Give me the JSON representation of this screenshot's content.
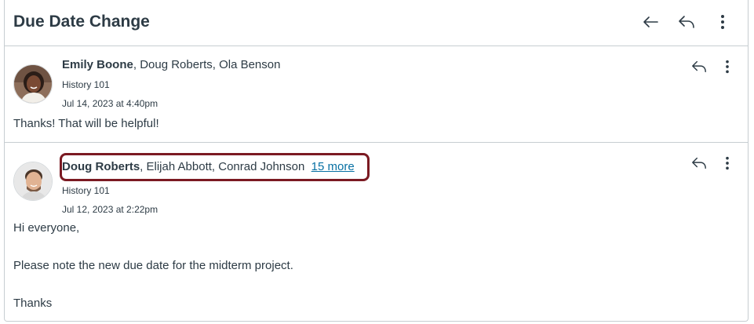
{
  "header": {
    "title": "Due Date Change",
    "icons": [
      "back-arrow-icon",
      "reply-icon",
      "more-vertical-icon"
    ]
  },
  "messages": [
    {
      "sender": "Emily Boone",
      "others": ", Doug Roberts, Ola Benson",
      "course": "History 101",
      "date": "Jul 14, 2023 at 4:40pm",
      "body": [
        "Thanks! That will be helpful!"
      ]
    },
    {
      "sender": "Doug Roberts",
      "others": ", Elijah Abbott, Conrad Johnson",
      "more": "15 more",
      "course": "History 101",
      "date": "Jul 12, 2023 at 2:22pm",
      "body": [
        "Hi everyone,",
        "Please note the new due date for the midterm project.",
        "Thanks"
      ]
    }
  ],
  "colors": {
    "link": "#0770a3",
    "highlight": "#7b1a22",
    "text": "#2d3b45",
    "border": "#c7cdd1"
  }
}
